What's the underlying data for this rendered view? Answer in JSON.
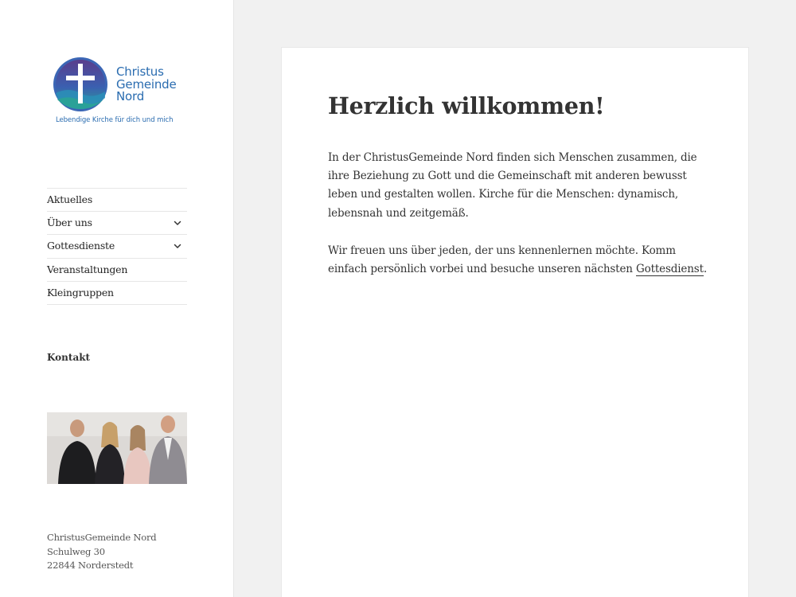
{
  "logo": {
    "line1": "Christus",
    "line2": "Gemeinde",
    "line3": "Nord",
    "tagline": "Lebendige Kirche für dich und mich",
    "colors": {
      "blue": "#2a6cb0",
      "purple": "#5a3d8c",
      "teal": "#2aa198"
    }
  },
  "nav": {
    "items": [
      {
        "label": "Aktuelles",
        "has_submenu": false
      },
      {
        "label": "Über uns",
        "has_submenu": true
      },
      {
        "label": "Gottesdienste",
        "has_submenu": true
      },
      {
        "label": "Veranstaltungen",
        "has_submenu": false
      },
      {
        "label": "Kleingruppen",
        "has_submenu": false
      }
    ],
    "submenu_icon": "chevron-down-icon"
  },
  "sidebar": {
    "widget_title": "Kontakt",
    "address": {
      "name": "ChristusGemeinde Nord",
      "street": "Schulweg 30",
      "city": "22844 Norderstedt"
    }
  },
  "main": {
    "title": "Herzlich willkommen!",
    "paragraph1": "In der ChristusGemeinde Nord finden sich Menschen zusammen, die ihre Beziehung zu Gott und die Gemeinschaft mit anderen bewusst leben und gestalten wollen. Kirche für die Menschen: dynamisch, lebensnah und zeitgemäß.",
    "paragraph2_text": "Wir freuen uns über jeden, der uns kennenlernen möchte. Komm einfach persönlich vorbei und besuche unseren nächsten ",
    "paragraph2_link": "Gottesdienst",
    "paragraph2_end": "."
  }
}
